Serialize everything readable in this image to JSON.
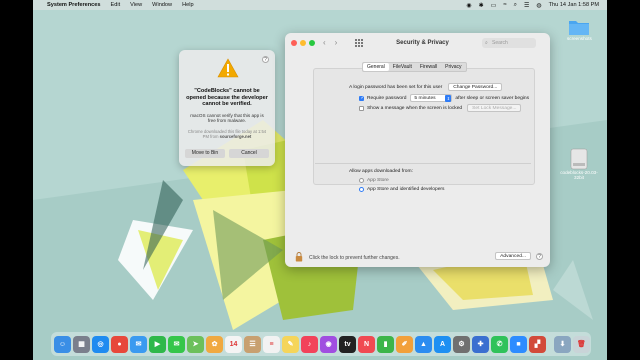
{
  "menubar": {
    "items": [
      "System Preferences",
      "Edit",
      "View",
      "Window",
      "Help"
    ],
    "clock": "Thu 14 Jan  1:58 PM"
  },
  "desktop": {
    "icons": [
      {
        "name": "folder-icon",
        "label": "screenshots"
      },
      {
        "name": "disk-icon",
        "label": "codeblocks-20.03-32bit"
      }
    ]
  },
  "dialog": {
    "title": "\"CodeBlocks\" cannot be opened because the developer cannot be verified.",
    "body": "macOS cannot verify that this app is free from malware.",
    "source_prefix": "Chrome downloaded this file today at 1:54 PM from ",
    "source_site": "sourceforge.net",
    "move_button": "Move to Bin",
    "cancel_button": "Cancel",
    "help": "?"
  },
  "prefs": {
    "title": "Security & Privacy",
    "search_placeholder": "Search",
    "tabs": [
      "General",
      "FileVault",
      "Firewall",
      "Privacy"
    ],
    "active_tab": "General",
    "password_text": "A login password has been set for this user",
    "change_password": "Change Password...",
    "require_password_label": "Require password",
    "require_password_value": "5 minutes",
    "after_sleep_text": "after sleep or screen saver begins",
    "show_message_label": "Show a message when the screen is locked",
    "set_lock_message": "Set Lock Message...",
    "allow_label": "Allow apps downloaded from:",
    "options": [
      "App Store",
      "App Store and identified developers"
    ],
    "selected_option": "App Store and identified developers",
    "lock_text": "Click the lock to prevent further changes.",
    "advanced": "Advanced...",
    "help": "?"
  },
  "colors": {
    "accent": "#2f7cf6",
    "warning": "#f2a900"
  },
  "dock": {
    "apps": [
      {
        "name": "finder-icon",
        "glyph": "☺",
        "bg": "#3a8ee6"
      },
      {
        "name": "launchpad-icon",
        "glyph": "▦",
        "bg": "#7a7f8c"
      },
      {
        "name": "safari-icon",
        "glyph": "◎",
        "bg": "#1f8bf0"
      },
      {
        "name": "chrome-icon",
        "glyph": "●",
        "bg": "#e7483b"
      },
      {
        "name": "mail-icon",
        "glyph": "✉",
        "bg": "#3a9af0"
      },
      {
        "name": "facetime-icon",
        "glyph": "▶",
        "bg": "#2fb84a"
      },
      {
        "name": "messages-icon",
        "glyph": "✉",
        "bg": "#35c64a"
      },
      {
        "name": "maps-icon",
        "glyph": "➤",
        "bg": "#6cc05b"
      },
      {
        "name": "photos-icon",
        "glyph": "✿",
        "bg": "#f0a940"
      },
      {
        "name": "calendar-icon",
        "glyph": "14",
        "bg": "#f4f4f4"
      },
      {
        "name": "contacts-icon",
        "glyph": "☰",
        "bg": "#c8a070"
      },
      {
        "name": "reminders-icon",
        "glyph": "≡",
        "bg": "#f2f2f2"
      },
      {
        "name": "notes-icon",
        "glyph": "✎",
        "bg": "#f5d55a"
      },
      {
        "name": "music-icon",
        "glyph": "♪",
        "bg": "#f2435a"
      },
      {
        "name": "podcasts-icon",
        "glyph": "◉",
        "bg": "#a04ee0"
      },
      {
        "name": "tv-icon",
        "glyph": "tv",
        "bg": "#222222"
      },
      {
        "name": "news-icon",
        "glyph": "N",
        "bg": "#f04a52"
      },
      {
        "name": "numbers-icon",
        "glyph": "▮",
        "bg": "#3cb54a"
      },
      {
        "name": "pages-icon",
        "glyph": "✐",
        "bg": "#f2a03a"
      },
      {
        "name": "keynote-icon",
        "glyph": "▲",
        "bg": "#2b8cf0"
      },
      {
        "name": "appstore-icon",
        "glyph": "A",
        "bg": "#1d8ff2"
      },
      {
        "name": "system-preferences-icon",
        "glyph": "⚙",
        "bg": "#707070"
      },
      {
        "name": "unknown-app-icon",
        "glyph": "✚",
        "bg": "#3a6fd0"
      },
      {
        "name": "whatsapp-icon",
        "glyph": "✆",
        "bg": "#2fc25a"
      },
      {
        "name": "zoom-icon",
        "glyph": "■",
        "bg": "#2d8cff"
      },
      {
        "name": "codeblocks-icon",
        "glyph": "▞",
        "bg": "#d24a3a"
      },
      {
        "name": "downloads-icon",
        "glyph": "⬇",
        "bg": "#8aa6c0"
      },
      {
        "name": "trash-icon",
        "glyph": "🗑",
        "bg": "#c9d4d8"
      }
    ]
  }
}
